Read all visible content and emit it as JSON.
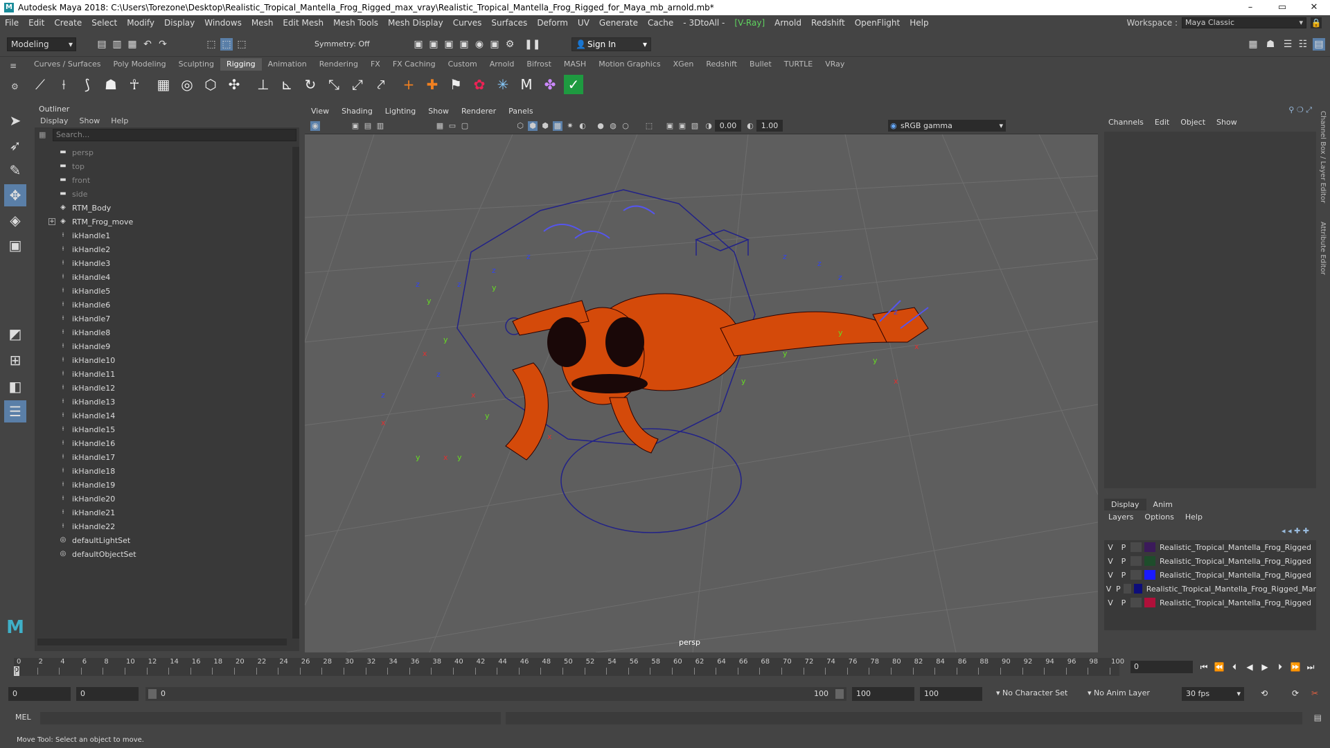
{
  "title": "Autodesk Maya 2018: C:\\Users\\Torezone\\Desktop\\Realistic_Tropical_Mantella_Frog_Rigged_max_vray\\Realistic_Tropical_Mantella_Frog_Rigged_for_Maya_mb_arnold.mb*",
  "window_controls": {
    "minimize": "–",
    "maximize": "▭",
    "close": "✕"
  },
  "menu": [
    "File",
    "Edit",
    "Create",
    "Select",
    "Modify",
    "Display",
    "Windows",
    "Mesh",
    "Edit Mesh",
    "Mesh Tools",
    "Mesh Display",
    "Curves",
    "Surfaces",
    "Deform",
    "UV",
    "Generate",
    "Cache",
    "- 3DtoAll -",
    "[V-Ray]",
    "Arnold",
    "Redshift",
    "OpenFlight",
    "Help"
  ],
  "workspace": {
    "label": "Workspace :",
    "value": "Maya Classic"
  },
  "toolbar": {
    "mode": "Modeling",
    "symmetry": "Symmetry: Off",
    "sign_in": "Sign In"
  },
  "shelf_tabs": [
    "Curves / Surfaces",
    "Poly Modeling",
    "Sculpting",
    "Rigging",
    "Animation",
    "Rendering",
    "FX",
    "FX Caching",
    "Custom",
    "Arnold",
    "Bifrost",
    "MASH",
    "Motion Graphics",
    "XGen",
    "Redshift",
    "Bullet",
    "TURTLE",
    "VRay"
  ],
  "active_shelf": "Rigging",
  "outliner": {
    "title": "Outliner",
    "menu": [
      "Display",
      "Show",
      "Help"
    ],
    "search_placeholder": "Search...",
    "items": [
      {
        "label": "persp",
        "type": "camera"
      },
      {
        "label": "top",
        "type": "camera"
      },
      {
        "label": "front",
        "type": "camera"
      },
      {
        "label": "side",
        "type": "camera"
      },
      {
        "label": "RTM_Body",
        "type": "mesh"
      },
      {
        "label": "RTM_Frog_move",
        "type": "group"
      },
      {
        "label": "ikHandle1",
        "type": "ik"
      },
      {
        "label": "ikHandle2",
        "type": "ik"
      },
      {
        "label": "ikHandle3",
        "type": "ik"
      },
      {
        "label": "ikHandle4",
        "type": "ik"
      },
      {
        "label": "ikHandle5",
        "type": "ik"
      },
      {
        "label": "ikHandle6",
        "type": "ik"
      },
      {
        "label": "ikHandle7",
        "type": "ik"
      },
      {
        "label": "ikHandle8",
        "type": "ik"
      },
      {
        "label": "ikHandle9",
        "type": "ik"
      },
      {
        "label": "ikHandle10",
        "type": "ik"
      },
      {
        "label": "ikHandle11",
        "type": "ik"
      },
      {
        "label": "ikHandle12",
        "type": "ik"
      },
      {
        "label": "ikHandle13",
        "type": "ik"
      },
      {
        "label": "ikHandle14",
        "type": "ik"
      },
      {
        "label": "ikHandle15",
        "type": "ik"
      },
      {
        "label": "ikHandle16",
        "type": "ik"
      },
      {
        "label": "ikHandle17",
        "type": "ik"
      },
      {
        "label": "ikHandle18",
        "type": "ik"
      },
      {
        "label": "ikHandle19",
        "type": "ik"
      },
      {
        "label": "ikHandle20",
        "type": "ik"
      },
      {
        "label": "ikHandle21",
        "type": "ik"
      },
      {
        "label": "ikHandle22",
        "type": "ik"
      },
      {
        "label": "defaultLightSet",
        "type": "set"
      },
      {
        "label": "defaultObjectSet",
        "type": "set"
      }
    ]
  },
  "viewport": {
    "menu": [
      "View",
      "Shading",
      "Lighting",
      "Show",
      "Renderer",
      "Panels"
    ],
    "exposure": "0.00",
    "gamma_value": "1.00",
    "color_space": "sRGB gamma",
    "camera_label": "persp"
  },
  "channel_box": {
    "menu": [
      "Channels",
      "Edit",
      "Object",
      "Show"
    ],
    "side_tabs": [
      "Channel Box / Layer Editor",
      "Attribute Editor"
    ]
  },
  "layer_editor": {
    "tabs": [
      "Display",
      "Anim"
    ],
    "menu": [
      "Layers",
      "Options",
      "Help"
    ],
    "layers": [
      {
        "v": "V",
        "p": "P",
        "color": "#3b1a5a",
        "name": "Realistic_Tropical_Mantella_Frog_Rigged"
      },
      {
        "v": "V",
        "p": "P",
        "color": "#1e4d2b",
        "name": "Realistic_Tropical_Mantella_Frog_Rigged"
      },
      {
        "v": "V",
        "p": "P",
        "color": "#1a1aff",
        "name": "Realistic_Tropical_Mantella_Frog_Rigged"
      },
      {
        "v": "V",
        "p": "P",
        "color": "#0d0d7a",
        "name": "Realistic_Tropical_Mantella_Frog_Rigged_Mar"
      },
      {
        "v": "V",
        "p": "P",
        "color": "#b0103a",
        "name": "Realistic_Tropical_Mantella_Frog_Rigged"
      }
    ]
  },
  "timeline": {
    "ticks": [
      "0",
      "2",
      "4",
      "6",
      "8",
      "10",
      "12",
      "14",
      "16",
      "18",
      "20",
      "22",
      "24",
      "26",
      "28",
      "30",
      "32",
      "34",
      "36",
      "38",
      "40",
      "42",
      "44",
      "46",
      "48",
      "50",
      "52",
      "54",
      "56",
      "58",
      "60",
      "62",
      "64",
      "66",
      "68",
      "70",
      "72",
      "74",
      "76",
      "78",
      "80",
      "82",
      "84",
      "86",
      "88",
      "90",
      "92",
      "94",
      "96",
      "98",
      "100"
    ],
    "current_frame": "0",
    "current_marker": "0"
  },
  "range": {
    "start": "0",
    "playback_start": "0",
    "slider_start": "0",
    "slider_end": "100",
    "playback_end": "100",
    "end": "100",
    "character_set": "No Character Set",
    "anim_layer": "No Anim Layer",
    "fps": "30 fps"
  },
  "mel_label": "MEL",
  "help_line": "Move Tool: Select an object to move."
}
